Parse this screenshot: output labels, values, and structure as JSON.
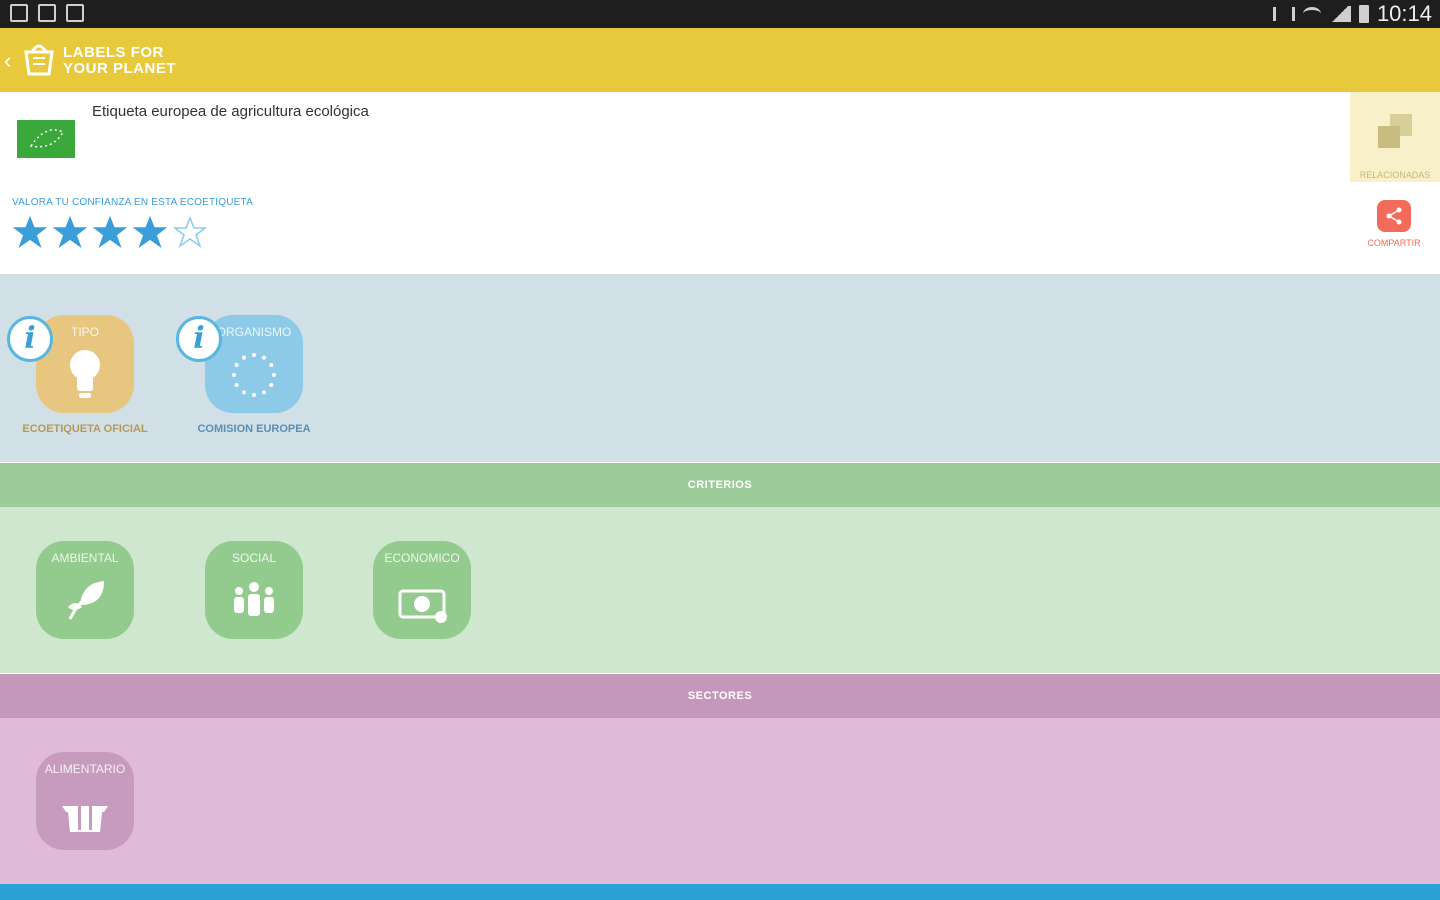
{
  "status": {
    "time": "10:14"
  },
  "app": {
    "brand_line1": "LABELS FOR",
    "brand_line2": "YOUR PLANET"
  },
  "label": {
    "title": "Etiqueta europea de agricultura ecológica",
    "rate_prompt": "VALORA TU CONFIANZA EN ESTA ECOETIQUETA",
    "rating": 4,
    "rating_max": 5
  },
  "actions": {
    "related": "RELACIONADAS",
    "share": "COMPARTIR"
  },
  "info": {
    "type": {
      "caption": "TIPO",
      "value": "ECOETIQUETA OFICIAL",
      "icon": "lightbulb-icon"
    },
    "organism": {
      "caption": "ORGANISMO",
      "value": "COMISION EUROPEA",
      "icon": "eu-stars-icon"
    }
  },
  "criteria": {
    "header": "CRITERIOS",
    "items": [
      {
        "label": "AMBIENTAL",
        "icon": "leaf-icon"
      },
      {
        "label": "SOCIAL",
        "icon": "people-icon"
      },
      {
        "label": "ECONOMICO",
        "icon": "money-icon"
      }
    ]
  },
  "sectors": {
    "header": "SECTORES",
    "items": [
      {
        "label": "ALIMENTARIO",
        "icon": "cutlery-icon"
      }
    ]
  },
  "colors": {
    "appbar": "#e9c93c",
    "accent_blue": "#3a9fd8",
    "criteria": "#9dcb99",
    "sectors": "#c598bb",
    "share": "#f26b5b"
  }
}
